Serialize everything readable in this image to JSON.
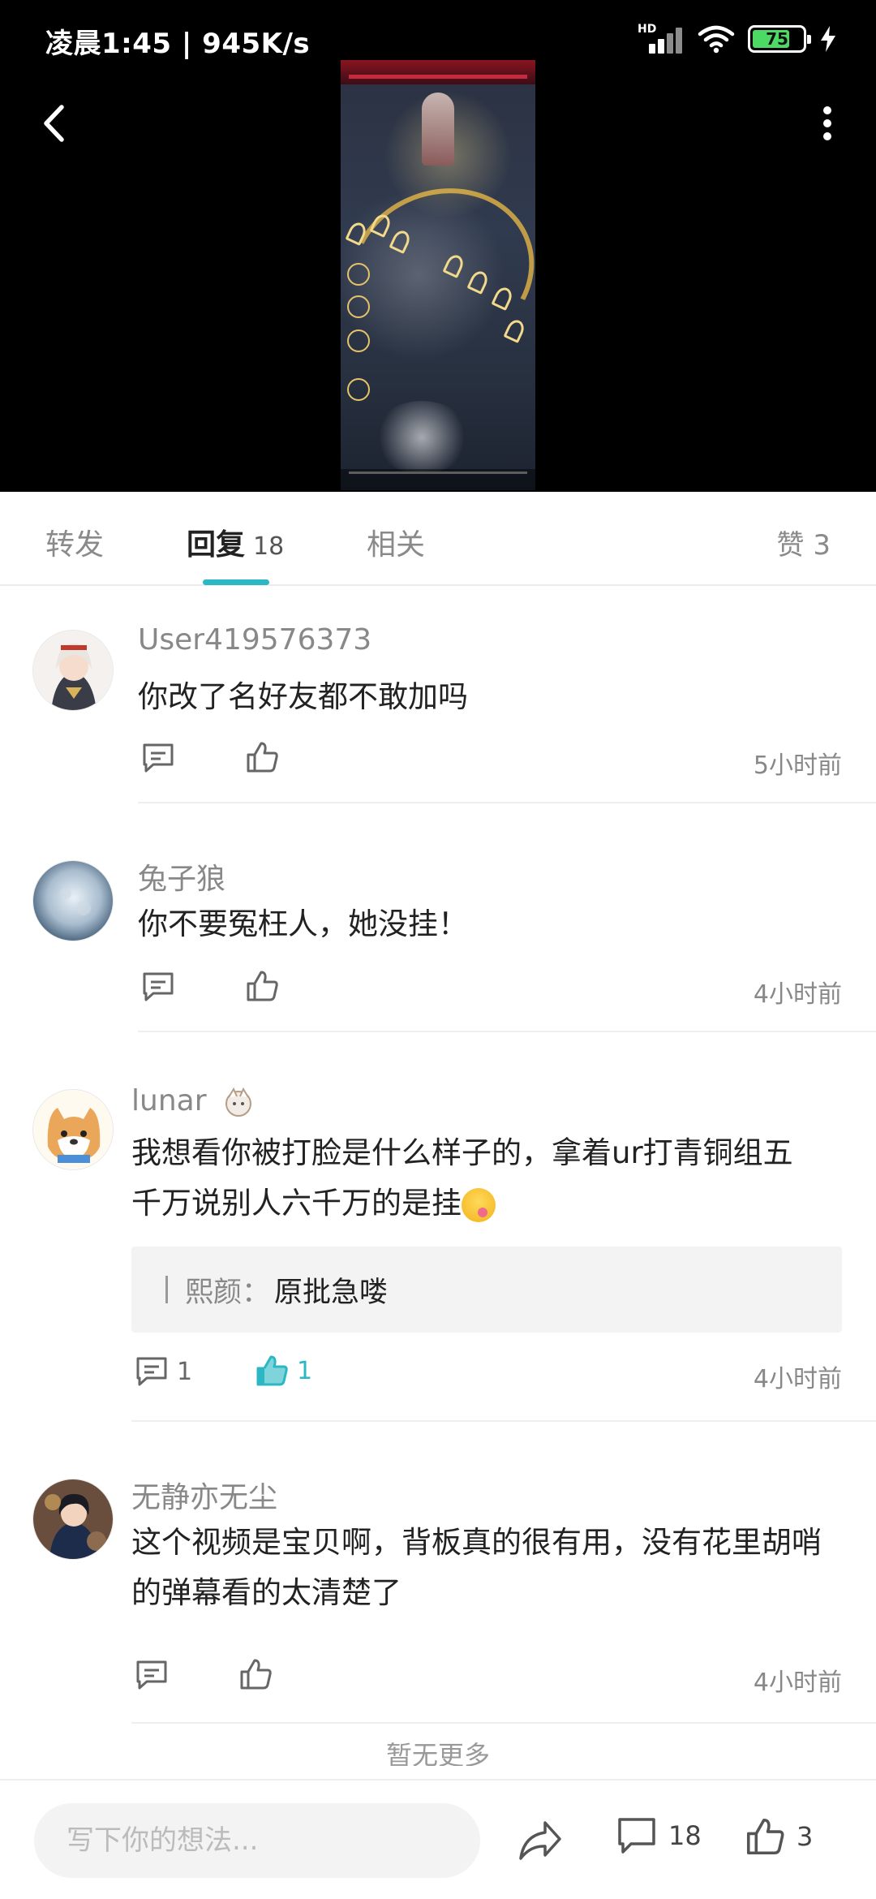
{
  "status_bar": {
    "time_speed": "凌晨1:45 | 945K/s",
    "hd_label": "HD",
    "battery": "75"
  },
  "tabs": [
    {
      "label": "转发",
      "count": ""
    },
    {
      "label": "回复",
      "count": "18"
    },
    {
      "label": "相关",
      "count": ""
    }
  ],
  "likes_tab": {
    "label": "赞",
    "count": "3"
  },
  "comments": [
    {
      "username": "User419576373",
      "text": "你改了名好友都不敢加吗",
      "time": "5小时前",
      "reply_count": "",
      "like_count": "",
      "liked": false
    },
    {
      "username": "兔子狼",
      "text": "你不要冤枉人，她没挂！",
      "time": "4小时前",
      "reply_count": "",
      "like_count": "",
      "liked": false
    },
    {
      "username": "lunar",
      "text_line1": "我想看你被打脸是什么样子的，拿着ur打青铜组五",
      "text_line2": "千万说别人六千万的是挂",
      "quote": {
        "name": "熙颜",
        "separator": "：",
        "text": "原批急喽"
      },
      "time": "4小时前",
      "reply_count": "1",
      "like_count": "1",
      "liked": true
    },
    {
      "username": "无静亦无尘",
      "text_line1": "这个视频是宝贝啊，背板真的很有用，没有花里胡哨",
      "text_line2": "的弹幕看的太清楚了",
      "time": "4小时前",
      "reply_count": "",
      "like_count": "",
      "liked": false
    }
  ],
  "more_hint": "暂无更多",
  "bottom_bar": {
    "input_placeholder": "写下你的想法...",
    "comment_count": "18",
    "like_count": "3"
  },
  "colors": {
    "accent": "#2bb7c4",
    "background": "#ffffff",
    "video_background": "#000000"
  },
  "icons": [
    "back-arrow-icon",
    "more-vertical-icon",
    "reply-icon",
    "thumbs-up-icon",
    "share-icon",
    "comment-icon",
    "wifi-icon",
    "charging-icon"
  ]
}
